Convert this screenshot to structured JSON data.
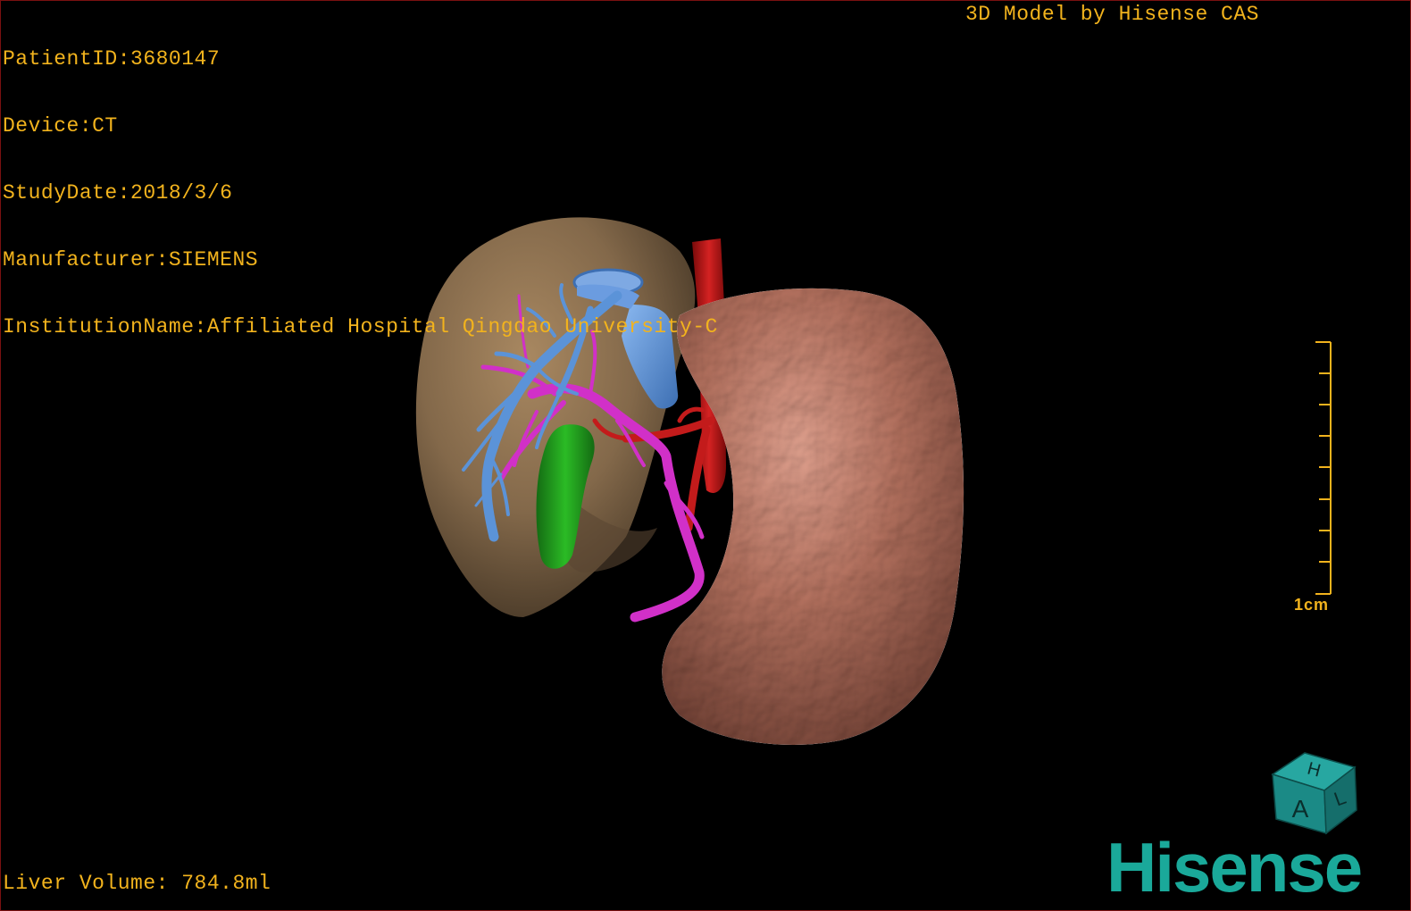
{
  "patient_info": {
    "patient_id": "PatientID:3680147",
    "device": "Device:CT",
    "study_date": "StudyDate:2018/3/6",
    "manufacturer": "Manufacturer:SIEMENS",
    "institution": "InstitutionName:Affiliated Hospital Qingdao University-C"
  },
  "model_credit": "3D Model by Hisense CAS",
  "liver_volume": "Liver Volume: 784.8ml",
  "scale": {
    "label": "1cm"
  },
  "orientation_cube": {
    "top_face": "H",
    "front_face": "A",
    "side_face": "L",
    "color": "#1b8a86"
  },
  "brand": "Hisense",
  "colors": {
    "overlay_text": "#f2b31d",
    "liver": "#8a6e4e",
    "spleen": "#b87461",
    "portal_vein": "#5b93d8",
    "hepatic_artery": "#c31b1b",
    "bile_duct": "#d130c8",
    "gallbladder": "#23a11e",
    "brand": "#1aa99a",
    "border": "#7a1010"
  }
}
